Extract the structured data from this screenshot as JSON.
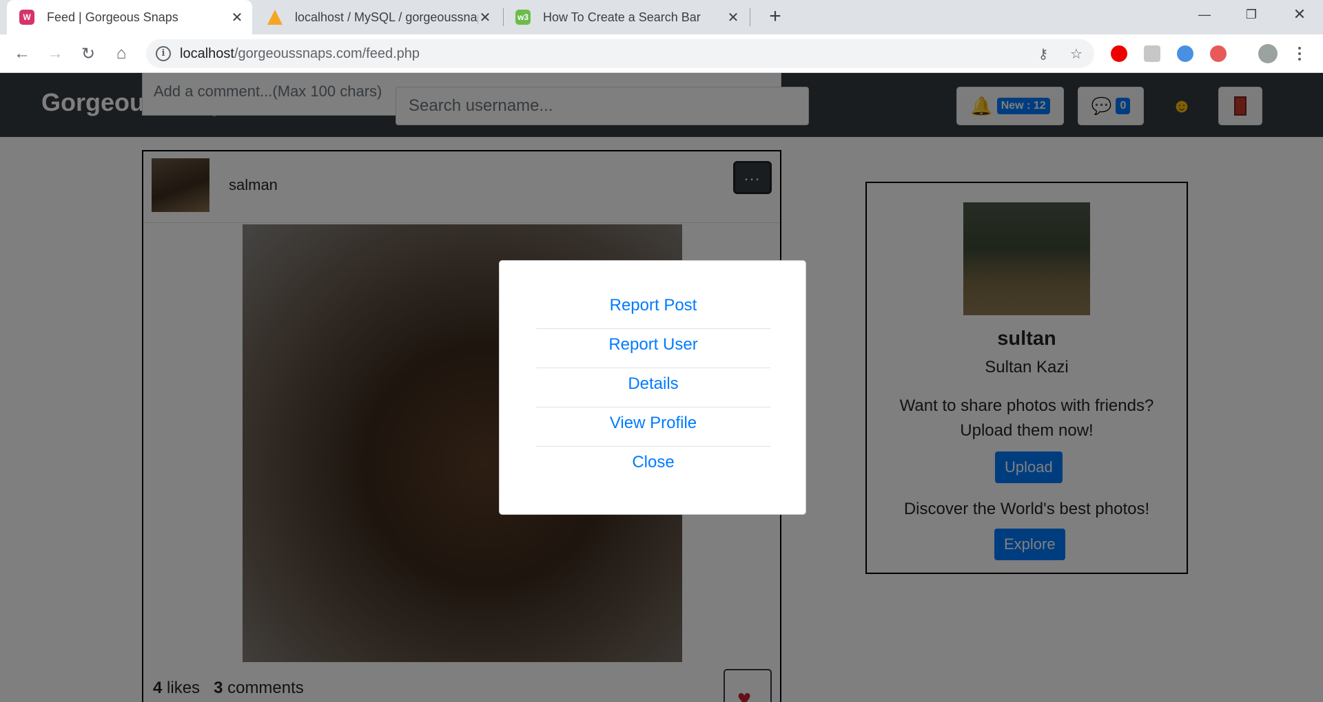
{
  "browser": {
    "tabs": [
      {
        "title": "Feed | Gorgeous Snaps",
        "active": true
      },
      {
        "title": "localhost / MySQL / gorgeoussnaps",
        "active": false
      },
      {
        "title": "How To Create a Search Bar",
        "active": false
      }
    ],
    "address": {
      "host": "localhost",
      "path": "/gorgeoussnaps.com/feed.php"
    }
  },
  "site": {
    "brand": "Gorgeous Snaps",
    "comment_placeholder": "Add a comment...(Max 100 chars)",
    "search_placeholder": "Search username...",
    "notifications_badge": "New : 12",
    "messages_badge": "0"
  },
  "post": {
    "username": "salman",
    "more_label": "...",
    "likes_count": "4",
    "likes_label": "likes",
    "comments_count": "3",
    "comments_label": "comments"
  },
  "profile_card": {
    "username": "sultan",
    "full_name": "Sultan Kazi",
    "share_line1": "Want to share photos with friends?",
    "share_line2": "Upload them now!",
    "upload_button": "Upload",
    "discover_text": "Discover the World's best photos!",
    "explore_button": "Explore"
  },
  "modal": {
    "items": [
      "Report Post",
      "Report User",
      "Details",
      "View Profile",
      "Close"
    ]
  },
  "colors": {
    "navbar": "#343a40",
    "primary": "#007bff",
    "tabstrip": "#dee1e6"
  }
}
